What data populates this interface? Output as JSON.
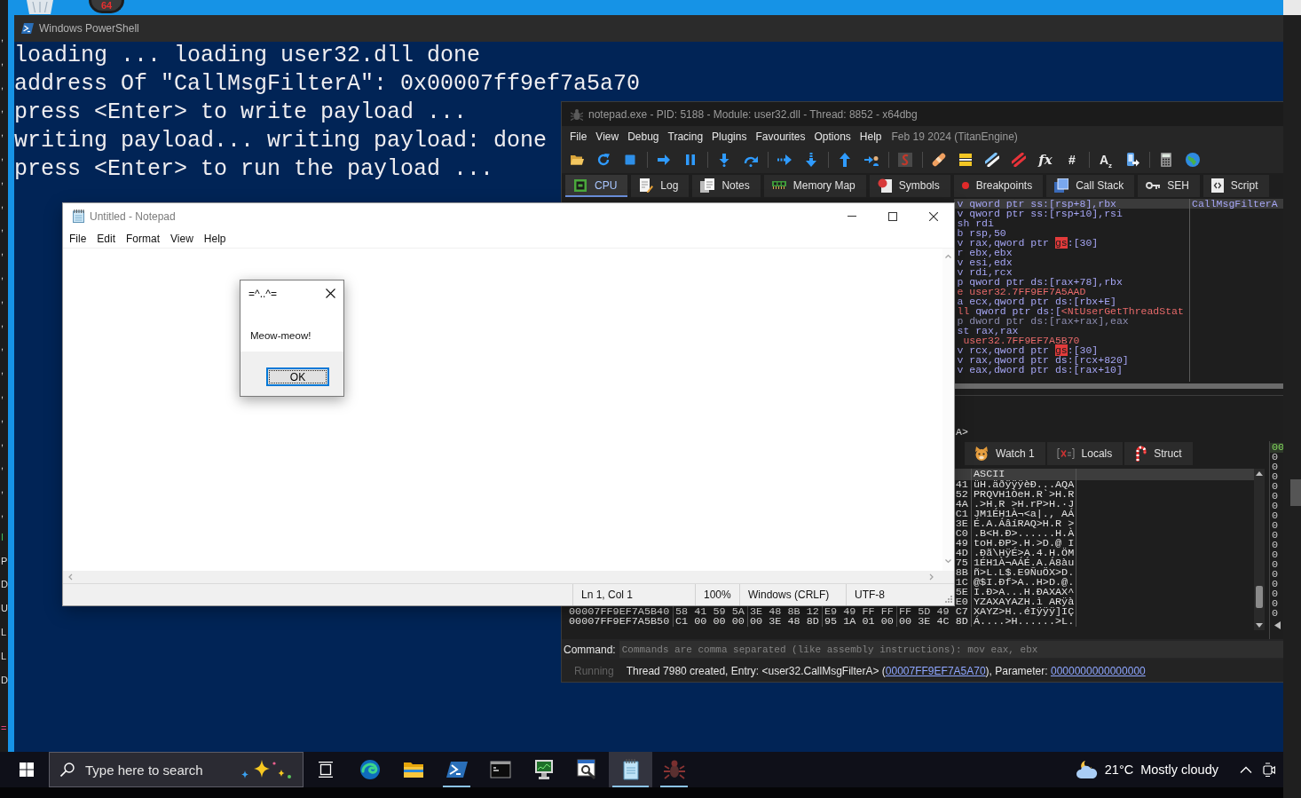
{
  "desktop": {
    "shortcut_label": "64"
  },
  "side_window": {
    "lines": [
      {
        "text": ","
      },
      {
        "text": ","
      },
      {
        "text": ","
      },
      {
        "text": ","
      },
      {
        "text": ","
      },
      {
        "text": ","
      },
      {
        "text": ","
      },
      {
        "text": ","
      },
      {
        "text": ","
      },
      {
        "text": ","
      },
      {
        "text": ","
      },
      {
        "text": ","
      },
      {
        "text": ","
      },
      {
        "text": ","
      },
      {
        "text": ","
      },
      {
        "text": ","
      },
      {
        "text": ","
      },
      {
        "text": ","
      },
      {
        "text": ","
      },
      {
        "text": ","
      },
      {
        "text": ","
      },
      {
        "text": "I",
        "color": "#3fbf5f"
      },
      {
        "text": "P"
      },
      {
        "text": "D"
      },
      {
        "text": "U"
      },
      {
        "text": "L"
      },
      {
        "text": "L"
      },
      {
        "text": "D"
      }
    ],
    "end_mark": {
      "text": "=",
      "color": "#e0457b"
    }
  },
  "powershell": {
    "title": "Windows PowerShell",
    "lines": [
      "loading ... loading user32.dll done",
      "address Of \"CallMsgFilterA\": 0x00007ff9ef7a5a70",
      "press <Enter> to write payload ...",
      "writing payload... writing payload: done",
      "press <Enter> to run the payload ..."
    ]
  },
  "x64dbg": {
    "title": "notepad.exe - PID: 5188 - Module: user32.dll - Thread: 8852 - x64dbg",
    "menu": [
      "File",
      "View",
      "Debug",
      "Tracing",
      "Plugins",
      "Favourites",
      "Options",
      "Help"
    ],
    "build_info": "Feb 19 2024 (TitanEngine)",
    "toolbar_glyphs": [
      {
        "text": "fx",
        "kind": "italic"
      },
      {
        "text": "#",
        "kind": "plain"
      },
      {
        "text": "A$_{z}$",
        "kind": "plain"
      }
    ],
    "tabs": [
      {
        "label": "CPU",
        "selected": true
      },
      {
        "label": "Log",
        "selected": false
      },
      {
        "label": "Notes",
        "selected": false
      },
      {
        "label": "Memory Map",
        "selected": false
      },
      {
        "label": "Symbols",
        "selected": false
      },
      {
        "label": "Breakpoints",
        "selected": false
      },
      {
        "label": "Call Stack",
        "selected": false
      },
      {
        "label": "SEH",
        "selected": false
      },
      {
        "label": "Script",
        "selected": false
      }
    ],
    "disassembly": [
      {
        "selected": true,
        "parts": [
          {
            "text": "v qword ptr ss:[rsp+8],rbx",
            "kind": "code"
          }
        ],
        "comment": "CallMsgFilterA"
      },
      {
        "selected": false,
        "parts": [
          {
            "text": "v qword ptr ss:[rsp+10],rsi",
            "kind": "code"
          }
        ]
      },
      {
        "selected": false,
        "parts": [
          {
            "text": "sh rdi",
            "kind": "code"
          }
        ]
      },
      {
        "selected": false,
        "parts": [
          {
            "text": "b rsp,50",
            "kind": "code"
          }
        ]
      },
      {
        "selected": false,
        "parts": [
          {
            "text": "v rax,qword ptr ",
            "kind": "code"
          },
          {
            "text": "gs",
            "kind": "alert"
          },
          {
            "text": ":[30]",
            "kind": "code"
          }
        ]
      },
      {
        "selected": false,
        "parts": [
          {
            "text": "r ebx,ebx",
            "kind": "code"
          }
        ]
      },
      {
        "selected": false,
        "parts": [
          {
            "text": "v esi,edx",
            "kind": "code"
          }
        ]
      },
      {
        "selected": false,
        "parts": [
          {
            "text": "v rdi,rcx",
            "kind": "code"
          }
        ]
      },
      {
        "selected": false,
        "parts": [
          {
            "text": "p qword ptr ds:[rax+78],rbx",
            "kind": "code"
          }
        ]
      },
      {
        "selected": false,
        "parts": [
          {
            "text": "e user32.7FF9EF7A5AAD",
            "kind": "jump"
          }
        ]
      },
      {
        "selected": false,
        "parts": [
          {
            "text": "a ecx,qword ptr ds:[rbx+E]",
            "kind": "code"
          }
        ]
      },
      {
        "selected": false,
        "parts": [
          {
            "text": "ll",
            "kind": "jump"
          },
          {
            "text": " qword ptr ds:[",
            "kind": "code"
          },
          {
            "text": "<NtUserGetThreadStat",
            "kind": "jump"
          }
        ]
      },
      {
        "selected": false,
        "parts": [
          {
            "text": "p dword ptr ds:[rax+rax],eax",
            "kind": "nop"
          }
        ]
      },
      {
        "selected": false,
        "parts": [
          {
            "text": "st rax,rax",
            "kind": "code"
          }
        ]
      },
      {
        "selected": false,
        "parts": [
          {
            "text": " user32.7FF9EF7A5B70",
            "kind": "jump"
          }
        ]
      },
      {
        "selected": false,
        "parts": [
          {
            "text": "v rcx,qword ptr ",
            "kind": "code"
          },
          {
            "text": "gs",
            "kind": "alert"
          },
          {
            "text": ":[30]",
            "kind": "code"
          }
        ]
      },
      {
        "selected": false,
        "parts": [
          {
            "text": "v rax,qword ptr ds:[rcx+820]",
            "kind": "code"
          }
        ]
      },
      {
        "selected": false,
        "parts": [
          {
            "text": "v eax,dword ptr ds:[rax+10]",
            "kind": "code"
          }
        ]
      }
    ],
    "info_line": "A>",
    "dump_tabs": [
      {
        "label": "Watch 1",
        "selected": false
      },
      {
        "label": "Locals",
        "selected": false
      },
      {
        "label": "Struct",
        "selected": false
      }
    ],
    "dump": {
      "ascii_header": "ASCII",
      "rows": [
        {
          "hex_end": "41",
          "ascii": "üH.äðÿÿÿèÐ...AQA"
        },
        {
          "hex_end": "52",
          "ascii": "PRQVH1ÒeH.R`>H.R"
        },
        {
          "hex_end": "4A",
          "ascii": ".>H.R >H.rP>H.·J"
        },
        {
          "hex_end": "C1",
          "ascii": "JM1ÉH1À¬<a|., AÁ"
        },
        {
          "hex_end": "3E",
          "ascii": "É.A.ÁâíRAQ>H.R >"
        },
        {
          "hex_end": "C0",
          "ascii": ".B<H.Ð>......H.À"
        },
        {
          "hex_end": "49",
          "ascii": "toH.ÐP>.H.>D.@ I"
        },
        {
          "hex_end": "4D",
          "ascii": ".Ðã\\HÿÉ>A.4.H.ÖM"
        },
        {
          "hex_end": "75",
          "ascii": "1ÉH1À¬AÁÉ.A.Á8àu"
        },
        {
          "hex_end": "8B",
          "ascii": "ñ>L.L$.E9ÑuÖX>D."
        },
        {
          "hex_end": "1C",
          "ascii": "@$I.Ðf>A..H>D.@."
        },
        {
          "hex_end": "5E",
          "ascii": "I.Ð>A...H.ÐAXAX^"
        },
        {
          "hex_end": "E0",
          "ascii": "YZAXAYAZH.ì ARÿà"
        },
        {
          "address": "00007FF9EF7A5B40",
          "hex": [
            "58 41 59 5A",
            "3E 48 8B 12",
            "E9 49 FF FF",
            "FF 5D 49 C7"
          ],
          "ascii": "XAYZ>H..éIÿÿÿ]IÇ"
        },
        {
          "address": "00007FF9EF7A5B50",
          "hex": [
            "C1 00 00 00",
            "00 3E 48 8D",
            "95 1A 01 00",
            "00 3E 4C 8D"
          ],
          "ascii": "Á....>H......>L."
        }
      ]
    },
    "stack": [
      {
        "text": "00",
        "selected": true
      },
      {
        "text": "0",
        "selected": false
      },
      {
        "text": "0",
        "selected": false
      },
      {
        "text": "0",
        "selected": false
      },
      {
        "text": "0",
        "selected": false
      },
      {
        "text": "0",
        "selected": false
      },
      {
        "text": "0",
        "selected": false
      },
      {
        "text": "0",
        "selected": false
      },
      {
        "text": "0",
        "selected": false
      },
      {
        "text": "0",
        "selected": false
      },
      {
        "text": "0",
        "selected": false
      },
      {
        "text": "0",
        "selected": false
      },
      {
        "text": "0",
        "selected": false
      },
      {
        "text": "0",
        "selected": false
      },
      {
        "text": "0",
        "selected": false
      },
      {
        "text": "0",
        "selected": false
      },
      {
        "text": "0",
        "selected": false
      },
      {
        "text": "0",
        "selected": false
      }
    ],
    "command": {
      "label": "Command:",
      "placeholder": "Commands are comma separated (like assembly instructions): mov eax, ebx"
    },
    "status": {
      "state": "Running",
      "message": [
        {
          "text": "Thread 7980 created, Entry: <user32.CallMsgFilterA> (",
          "link": false
        },
        {
          "text": "00007FF9EF7A5A70",
          "link": true
        },
        {
          "text": "), Parameter: ",
          "link": false
        },
        {
          "text": "0000000000000000",
          "link": true
        }
      ]
    }
  },
  "notepad": {
    "title": "Untitled - Notepad",
    "menu": [
      "File",
      "Edit",
      "Format",
      "View",
      "Help"
    ],
    "status": [
      "Ln 1, Col 1",
      "100%",
      "Windows (CRLF)",
      "UTF-8"
    ]
  },
  "message_box": {
    "title": "=^..^=",
    "text": "Meow-meow!",
    "button": "OK"
  },
  "taskbar": {
    "search_placeholder": "Type here to search",
    "apps": [
      {
        "running": false,
        "selected": false
      },
      {
        "running": false,
        "selected": false
      },
      {
        "running": true,
        "selected": false
      },
      {
        "running": false,
        "selected": false
      },
      {
        "running": false,
        "selected": false
      },
      {
        "running": false,
        "selected": false
      },
      {
        "running": true,
        "selected": true
      },
      {
        "running": true,
        "selected": false
      }
    ],
    "weather": {
      "temperature": "21°C",
      "condition": "Mostly cloudy"
    }
  }
}
